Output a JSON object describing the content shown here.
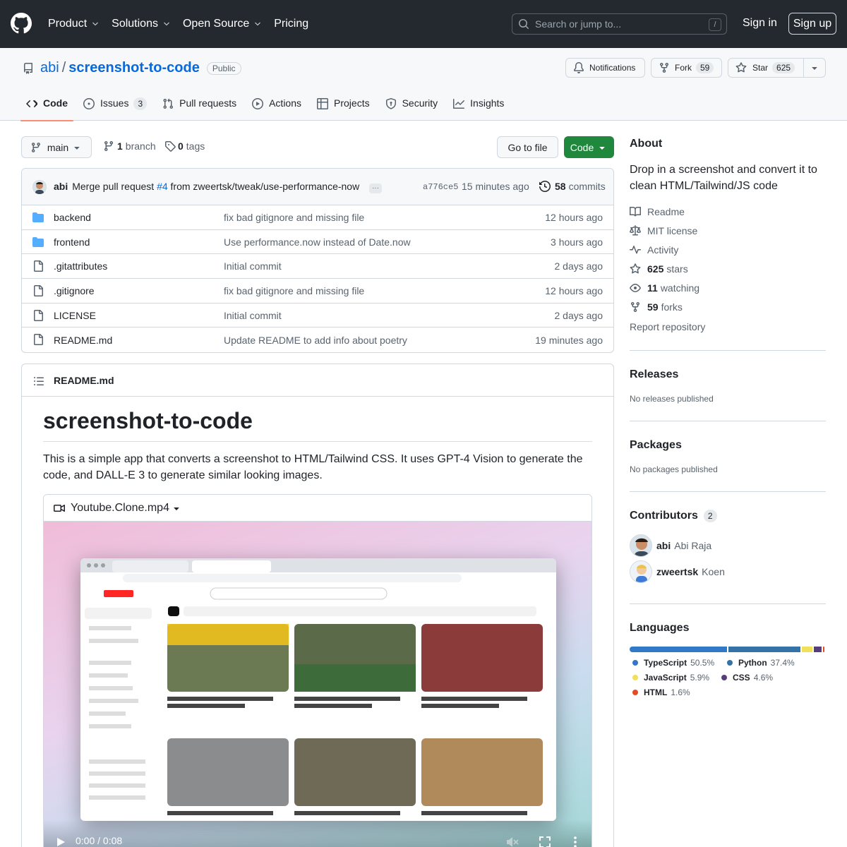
{
  "header": {
    "nav": [
      "Product",
      "Solutions",
      "Open Source",
      "Pricing"
    ],
    "search_placeholder": "Search or jump to...",
    "search_key": "/",
    "sign_in": "Sign in",
    "sign_up": "Sign up"
  },
  "repo": {
    "owner": "abi",
    "separator": "/",
    "name": "screenshot-to-code",
    "visibility": "Public",
    "notifications": "Notifications",
    "fork_label": "Fork",
    "fork_count": "59",
    "star_label": "Star",
    "star_count": "625"
  },
  "tabs": [
    {
      "label": "Code"
    },
    {
      "label": "Issues",
      "count": "3"
    },
    {
      "label": "Pull requests"
    },
    {
      "label": "Actions"
    },
    {
      "label": "Projects"
    },
    {
      "label": "Security"
    },
    {
      "label": "Insights"
    }
  ],
  "branchbar": {
    "branch": "main",
    "branch_count": "1",
    "branch_word": "branch",
    "tag_count": "0",
    "tag_word": "tags",
    "goto_file": "Go to file",
    "code_button": "Code"
  },
  "commit": {
    "author": "abi",
    "message_prefix": "Merge pull request",
    "pr": "#4",
    "message_suffix": "from zweertsk/tweak/use-performance-now",
    "ellipsis": "···",
    "hash": "a776ce5",
    "time": "15 minutes ago",
    "count": "58",
    "count_word": "commits"
  },
  "files": [
    {
      "type": "folder",
      "name": "backend",
      "message": "fix bad gitignore and missing file",
      "time": "12 hours ago"
    },
    {
      "type": "folder",
      "name": "frontend",
      "message": "Use performance.now instead of Date.now",
      "time": "3 hours ago"
    },
    {
      "type": "file",
      "name": ".gitattributes",
      "message": "Initial commit",
      "time": "2 days ago"
    },
    {
      "type": "file",
      "name": ".gitignore",
      "message": "fix bad gitignore and missing file",
      "time": "12 hours ago"
    },
    {
      "type": "file",
      "name": "LICENSE",
      "message": "Initial commit",
      "time": "2 days ago"
    },
    {
      "type": "file",
      "name": "README.md",
      "message": "Update README to add info about poetry",
      "time": "19 minutes ago"
    }
  ],
  "readme": {
    "filename": "README.md",
    "title": "screenshot-to-code",
    "intro": "This is a simple app that converts a screenshot to HTML/Tailwind CSS. It uses GPT-4 Vision to generate the code, and DALL-E 3 to generate similar looking images.",
    "video_name": "Youtube.Clone.mp4",
    "video_time": "0:00 / 0:08"
  },
  "about": {
    "heading": "About",
    "description": "Drop in a screenshot and convert it to clean HTML/Tailwind/JS code",
    "readme": "Readme",
    "license": "MIT license",
    "activity": "Activity",
    "stars_count": "625",
    "stars_word": "stars",
    "watching_count": "11",
    "watching_word": "watching",
    "forks_count": "59",
    "forks_word": "forks",
    "report": "Report repository"
  },
  "releases": {
    "heading": "Releases",
    "note": "No releases published"
  },
  "packages": {
    "heading": "Packages",
    "note": "No packages published"
  },
  "contributors": {
    "heading": "Contributors",
    "count": "2",
    "list": [
      {
        "login": "abi",
        "name": "Abi Raja"
      },
      {
        "login": "zweertsk",
        "name": "Koen"
      }
    ]
  },
  "languages": {
    "heading": "Languages",
    "list": [
      {
        "name": "TypeScript",
        "percent": "50.5%",
        "value": 50.5,
        "color": "#3178c6"
      },
      {
        "name": "Python",
        "percent": "37.4%",
        "value": 37.4,
        "color": "#3572A5"
      },
      {
        "name": "JavaScript",
        "percent": "5.9%",
        "value": 5.9,
        "color": "#f1e05a"
      },
      {
        "name": "CSS",
        "percent": "4.6%",
        "value": 4.6,
        "color": "#563d7c"
      },
      {
        "name": "HTML",
        "percent": "1.6%",
        "value": 1.6,
        "color": "#e34c26"
      }
    ]
  }
}
